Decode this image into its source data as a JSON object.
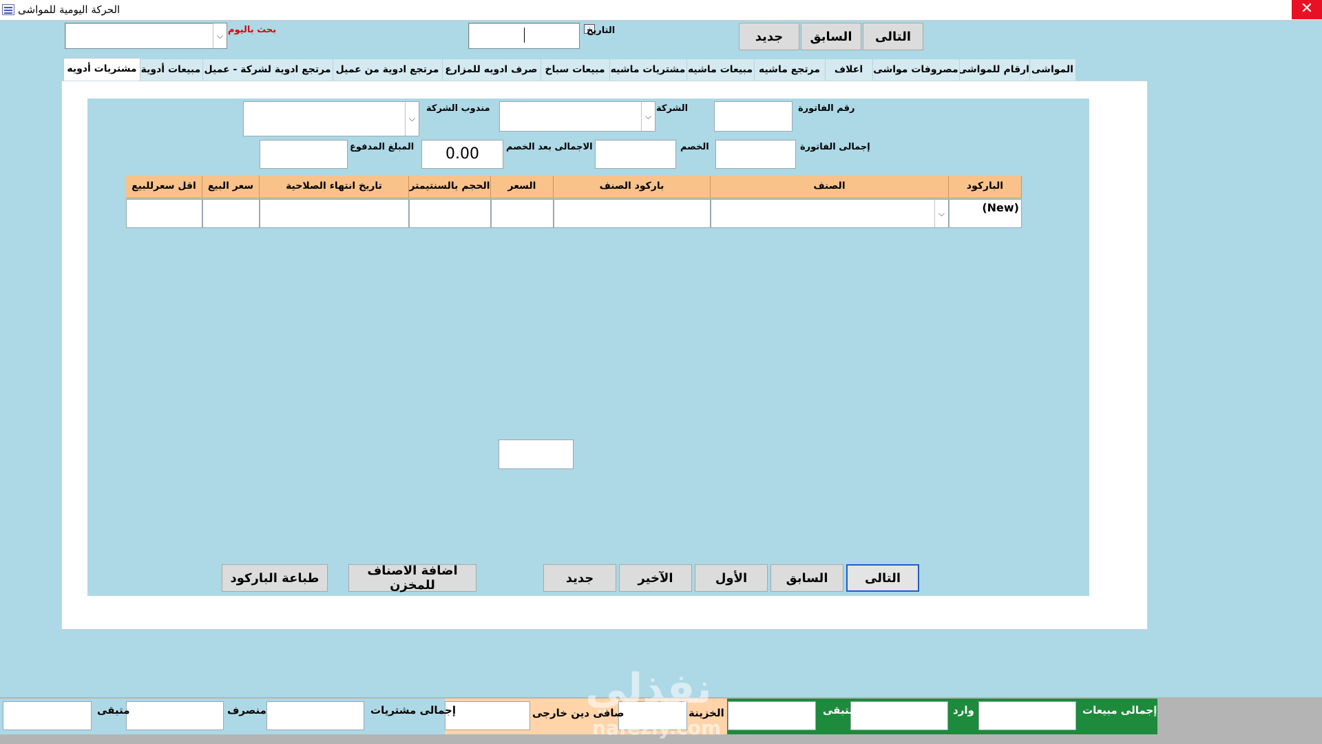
{
  "window": {
    "title": "الحركة اليومية للمواشى",
    "close_glyph": "✕"
  },
  "header": {
    "search_day_label": "بحث باليوم",
    "search_day_value": "",
    "date_label": "التاريخ",
    "date_value": "",
    "next_label": "التالى",
    "prev_label": "السابق",
    "new_label": "جديد"
  },
  "tabs": [
    {
      "label": "المواشى"
    },
    {
      "label": "ارقام للمواشى"
    },
    {
      "label": "مصروفات مواشى"
    },
    {
      "label": "اعلاف"
    },
    {
      "label": "مرتجع ماشيه"
    },
    {
      "label": "مبيعات ماشيه"
    },
    {
      "label": "مشتريات ماشيه"
    },
    {
      "label": "مبيعات سباخ"
    },
    {
      "label": "صرف ادويه للمزارع"
    },
    {
      "label": "مرتجع ادوية من عميل"
    },
    {
      "label": "مرتجع ادوية لشركة - عميل"
    },
    {
      "label": "مبيعات أدوية"
    },
    {
      "label": "مشتريات أدويه"
    }
  ],
  "active_tab": "مشتريات أدويه",
  "form": {
    "invoice_no_label": "رقم الفاتورة",
    "company_label": "الشركة",
    "rep_label": "مندوب الشركة",
    "invoice_total_label": "إجمالى الفاتورة",
    "discount_label": "الخصم",
    "total_after_discount_label": "الاجمالى بعد الخصم",
    "total_after_discount_value": "0.00",
    "paid_label": "المبلغ المدفوع"
  },
  "grid": {
    "columns": [
      "الباركود",
      "الصنف",
      "باركود الصنف",
      "السعر",
      "الحجم بالسنتيمتر",
      "تاريخ انتهاء الصلاحية",
      "سعر البيع",
      "اقل سعرللبيع"
    ],
    "new_row_label": "(New)",
    "dropdown_glyph": "⌵"
  },
  "nav_buttons": {
    "next": "التالى",
    "prev": "السابق",
    "first": "الأول",
    "last": "الآخير",
    "new": "جديد",
    "add_to_store": "اضافة الاصناف للمخزن",
    "print_barcode": "طباعة الباركود"
  },
  "footer": {
    "total_sales_label": "إجمالى مبيعات",
    "incoming_label": "وارد",
    "remaining_green_label": "متبقى",
    "treasury_label": "الخزينة",
    "external_debt_label": "صافى دين خارجى",
    "total_purchases_label": "إجمالى مشتريات",
    "spent_label": "منصرف",
    "remaining_label": "متبقى"
  },
  "watermark": {
    "arabic": "نفذلي",
    "latin": "nafezly.com"
  },
  "colors": {
    "background": "#add8e6",
    "grid_header": "#f8c28a",
    "footer_green": "#1e8a3c",
    "footer_orange": "#ffd4a8",
    "search_label_red": "#e00000",
    "close_red": "#e81123"
  }
}
